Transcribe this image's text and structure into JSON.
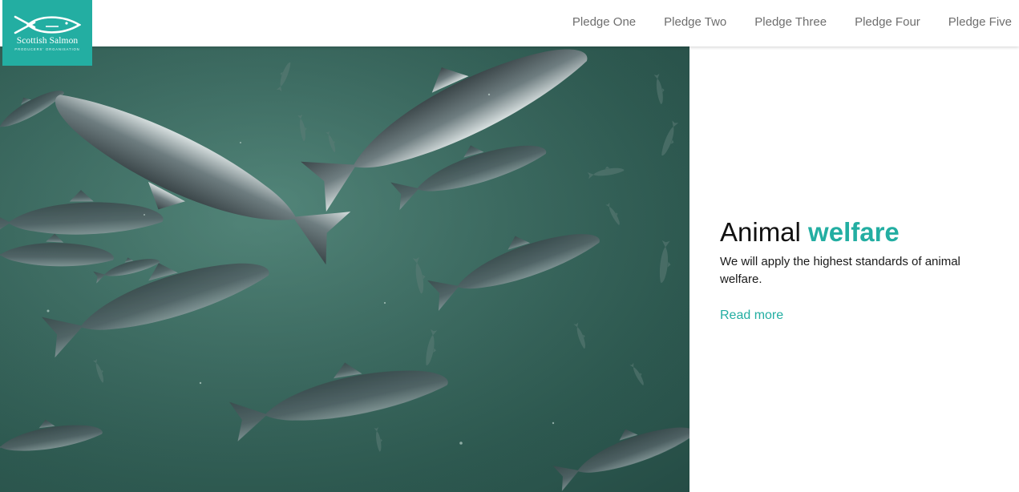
{
  "logo": {
    "brand": "Scottish Salmon",
    "sub": "PRODUCERS' ORGANISATION",
    "bg_color": "#23aea2"
  },
  "nav": {
    "items": [
      {
        "label": "Pledge One"
      },
      {
        "label": "Pledge Two"
      },
      {
        "label": "Pledge Three"
      },
      {
        "label": "Pledge Four"
      },
      {
        "label": "Pledge Five"
      }
    ]
  },
  "hero": {
    "icon": "salmon-underwater-image"
  },
  "content": {
    "heading_plain": "Animal",
    "heading_accent": "welfare",
    "description": "We will apply the highest standards of animal welfare.",
    "read_more": "Read more",
    "accent_color": "#23aea2"
  }
}
